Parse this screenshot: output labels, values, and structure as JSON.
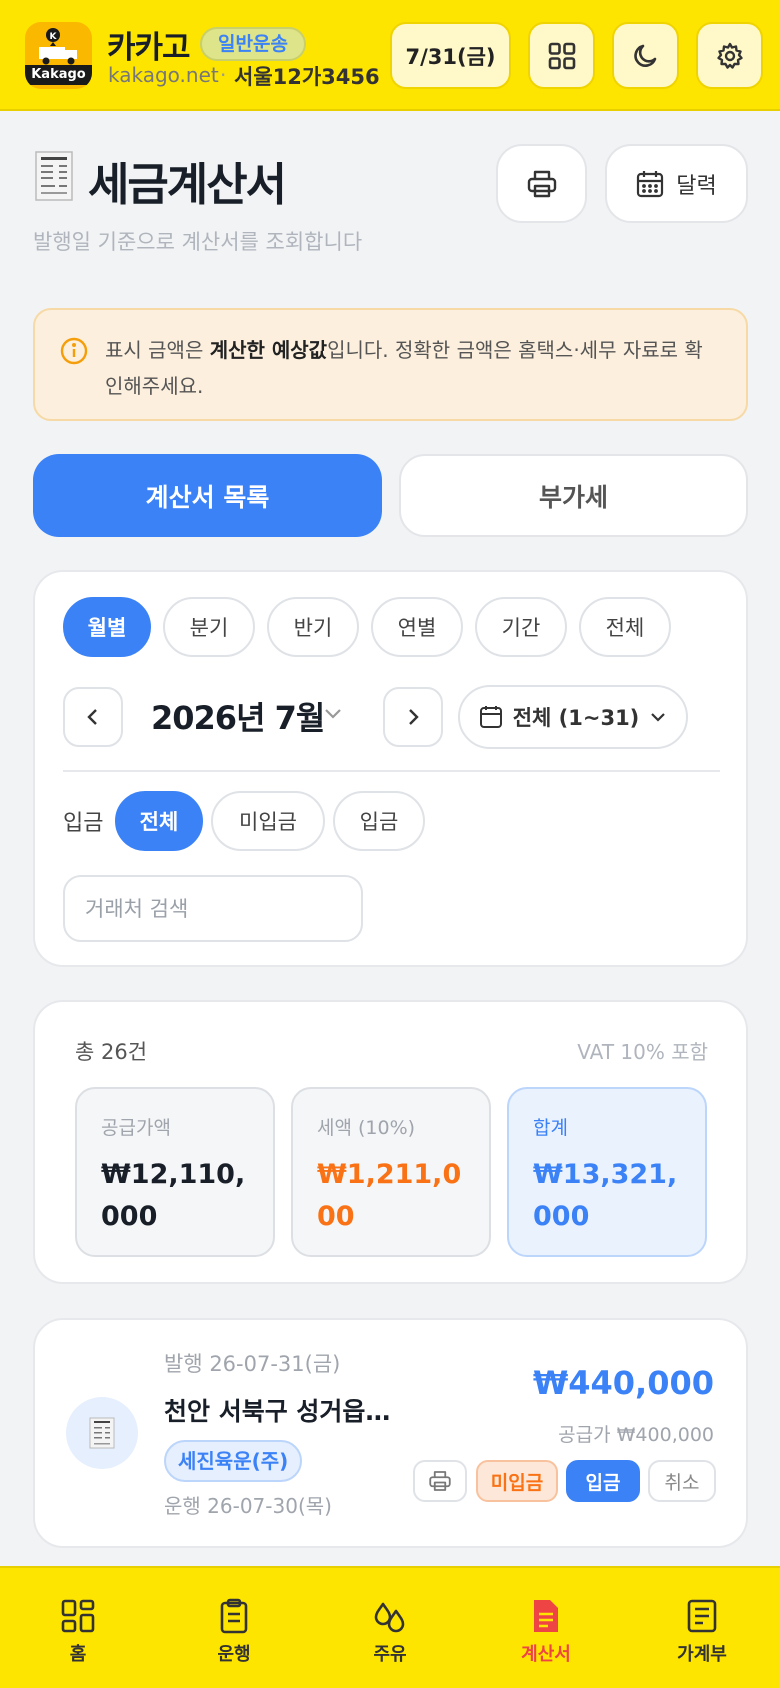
{
  "header": {
    "logo_text": "Kakago",
    "app_name": "카카고",
    "badge": "일반운송",
    "domain": "kakago.net",
    "separator": "·",
    "plate": "서울12가3456",
    "date": "7/31(금)"
  },
  "page": {
    "title": "세금계산서",
    "subtitle": "발행일 기준으로 계산서를 조회합니다",
    "calendar_label": "달력"
  },
  "notice": {
    "pre": "표시 금액은 ",
    "bold": "계산한 예상값",
    "post": "입니다. 정확한 금액은 홈택스·세무 자료로 확인해주세요."
  },
  "tabs": [
    "계산서 목록",
    "부가세"
  ],
  "filter": {
    "periods": [
      "월별",
      "분기",
      "반기",
      "연별",
      "기간",
      "전체"
    ],
    "selected_period": "월별",
    "month_label": "2026년 7월",
    "range_label": "전체 (1~31)",
    "pay_label": "입금",
    "pay_options": [
      "전체",
      "미입금",
      "입금"
    ],
    "search_placeholder": "거래처 검색"
  },
  "summary": {
    "count": "총 26건",
    "vat_note": "VAT 10% 포함",
    "supply_label": "공급가액",
    "supply_value": "₩12,110,000",
    "tax_label": "세액 (10%)",
    "tax_value": "₩1,211,000",
    "total_label": "합계",
    "total_value": "₩13,321,000"
  },
  "item": {
    "issue_date": "발행 26-07-31(금)",
    "title": "천안 서북구 성거읍…",
    "client": "세진육운(주)",
    "run_date": "운행 26-07-30(목)",
    "amount": "₩440,000",
    "supply": "공급가 ₩400,000",
    "unpaid_label": "미입금",
    "paid_label": "입금",
    "cancel_label": "취소"
  },
  "bottom_nav": [
    "홈",
    "운행",
    "주유",
    "계산서",
    "가계부"
  ],
  "colors": {
    "brand_yellow": "#fee500",
    "accent_blue": "#3b82f6",
    "orange": "#f97316",
    "active_red": "#ef4444"
  }
}
